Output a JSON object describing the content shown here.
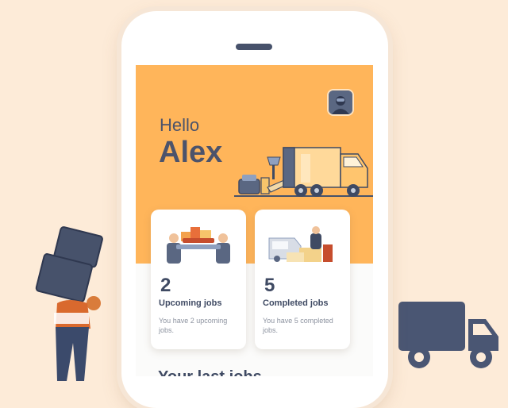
{
  "header": {
    "greeting": "Hello",
    "user_name": "Alex"
  },
  "cards": [
    {
      "count": "2",
      "title": "Upcoming jobs",
      "description": "You have 2 upcoming jobs."
    },
    {
      "count": "5",
      "title": "Completed jobs",
      "description": "You have 5 completed jobs."
    }
  ],
  "section": {
    "title": "Your last jobs"
  },
  "icons": {
    "avatar": "user-avatar-icon",
    "hero": "moving-truck-illustration",
    "card_upcoming": "movers-carrying-furniture-illustration",
    "card_completed": "delivered-van-illustration",
    "decor_person": "person-carrying-boxes-illustration",
    "decor_truck": "delivery-truck-icon"
  },
  "colors": {
    "background": "#fdebd8",
    "header": "#ffb55a",
    "text_dark": "#3f4a63",
    "text_muted": "#8d93a0",
    "accent_navy": "#4c5874"
  }
}
